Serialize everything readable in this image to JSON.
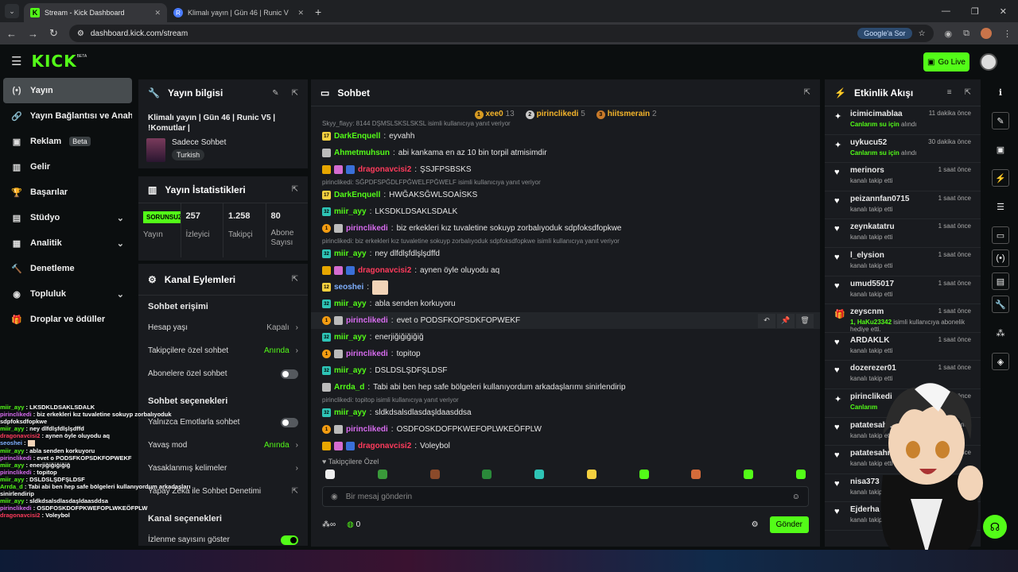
{
  "browser": {
    "tabs": [
      {
        "label": "Stream - Kick Dashboard",
        "active": true
      },
      {
        "label": "Klimalı yayın | Gün 46 | Runic V",
        "active": false
      }
    ],
    "url": "dashboard.kick.com/stream",
    "google_btn": "Google'a Sor"
  },
  "app": {
    "logo": "KICK",
    "beta": "BETA",
    "golive": "Go Live"
  },
  "sidebar": [
    {
      "icon": "(•)",
      "label": "Yayın",
      "active": true
    },
    {
      "icon": "🔗",
      "label": "Yayın Bağlantısı ve Anahtarı"
    },
    {
      "icon": "▣",
      "label": "Reklam",
      "badge": "Beta"
    },
    {
      "icon": "▥",
      "label": "Gelir"
    },
    {
      "icon": "🏆",
      "label": "Başarılar"
    },
    {
      "icon": "▤",
      "label": "Stüdyo",
      "chevron": true
    },
    {
      "icon": "▦",
      "label": "Analitik",
      "chevron": true
    },
    {
      "icon": "🔨",
      "label": "Denetleme"
    },
    {
      "icon": "◉",
      "label": "Topluluk",
      "chevron": true
    },
    {
      "icon": "🎁",
      "label": "Droplar ve ödüller"
    }
  ],
  "info": {
    "title": "Yayın bilgisi",
    "stream_title": "Klimalı yayın | Gün 46 | Runic V5 | !Komutlar |",
    "category": "Sadece Sohbet",
    "tag": "Turkish"
  },
  "stats": {
    "title": "Yayın İstatistikleri",
    "offline": "SORUNSUZ",
    "items": [
      {
        "label": "Yayın"
      },
      {
        "value": "257",
        "label": "İzleyici"
      },
      {
        "value": "1.258",
        "label": "Takipçi"
      },
      {
        "value": "80",
        "label": "Abone Sayısı"
      }
    ]
  },
  "actions": {
    "title": "Kanal Eylemleri",
    "sec1": "Sohbet erişimi",
    "r1": {
      "label": "Hesap yaşı",
      "value": "Kapalı"
    },
    "r2": {
      "label": "Takipçilere özel sohbet",
      "value": "Anında"
    },
    "r3": {
      "label": "Abonelere özel sohbet"
    },
    "sec2": "Sohbet seçenekleri",
    "r4": {
      "label": "Yalnızca Emotlarla sohbet"
    },
    "r5": {
      "label": "Yavaş mod",
      "value": "Anında"
    },
    "r6": {
      "label": "Yasaklanmış kelimeler"
    },
    "r7": {
      "label": "Yapay Zeka ile Sohbet Denetimi"
    },
    "sec3": "Kanal seçenekleri",
    "r8": {
      "label": "İzlenme sayısını göster"
    }
  },
  "chat": {
    "title": "Sohbet",
    "leaders": [
      {
        "rank": "1",
        "name": "xee0",
        "count": "13",
        "color": "#d69a22"
      },
      {
        "rank": "2",
        "name": "pirinclikedi",
        "count": "5",
        "color": "#c8c8c8"
      },
      {
        "rank": "3",
        "name": "hiitsmerain",
        "count": "2",
        "color": "#c87a2a"
      }
    ],
    "messages": [
      {
        "reply": "Skyy_flayy: 8144 DŞMSLSKSLSKSL isimli kullanıcıya yanıt veriyor"
      },
      {
        "badges": [
          "y:17"
        ],
        "user": "DarkEnquell",
        "color": "#53fc18",
        "text": "eyvahh"
      },
      {
        "badges": [
          "gh:"
        ],
        "user": "Ahmetmuhsun",
        "color": "#53fc18",
        "text": "abi kankama en az 10 bin torpil atmisimdir"
      },
      {
        "badges": [
          "c:",
          "p:",
          "s:"
        ],
        "user": "dragonavcisi2",
        "color": "#ff3b5c",
        "text": "ŞSJFPSBSKS"
      },
      {
        "reply": "pirinclikedi: SĞPDFSPĞDLFPĞWELFPĞWELF isimli kullanıcıya yanıt veriyor"
      },
      {
        "badges": [
          "y:17"
        ],
        "user": "DarkEnquell",
        "color": "#53fc18",
        "text": "HWĞAKSĞWLSOAİSKS"
      },
      {
        "badges": [
          "t:32"
        ],
        "user": "miir_ayy",
        "color": "#53fc18",
        "text": "LKSDKLDSAKLSDALK"
      },
      {
        "badges": [
          "o:1",
          "gh:"
        ],
        "user": "pirinclikedi",
        "color": "#d86cf0",
        "text": "biz erkekleri kız tuvaletine sokuyp zorbalıyoduk sdpfoksdfopkwe"
      },
      {
        "reply": "pirinclikedi: biz erkekleri kız tuvaletine sokuyp zorbalıyoduk sdpfoksdfopkwe isimli kullanıcıya yanıt veriyor"
      },
      {
        "badges": [
          "t:32"
        ],
        "user": "miir_ayy",
        "color": "#53fc18",
        "text": "ney dlfdlşfdlşlşdffd"
      },
      {
        "badges": [
          "c:",
          "p:",
          "s:"
        ],
        "user": "dragonavcisi2",
        "color": "#ff3b5c",
        "text": "aynen öyle oluyodu aq"
      },
      {
        "badges": [
          "y:12"
        ],
        "user": "seoshei",
        "color": "#7fb0ff",
        "text": "",
        "emote": true
      },
      {
        "badges": [
          "t:32"
        ],
        "user": "miir_ayy",
        "color": "#53fc18",
        "text": "abla senden korkuyoru"
      },
      {
        "badges": [
          "o:1",
          "gh:"
        ],
        "user": "pirinclikedi",
        "color": "#d86cf0",
        "text": "evet o PODSFKOPSDKFOPWEKF",
        "hover": true
      },
      {
        "badges": [
          "t:32"
        ],
        "user": "miir_ayy",
        "color": "#53fc18",
        "text": "enerjiğiğiğiğiğ"
      },
      {
        "badges": [
          "o:1",
          "gh:"
        ],
        "user": "pirinclikedi",
        "color": "#d86cf0",
        "text": "topitop"
      },
      {
        "badges": [
          "t:32"
        ],
        "user": "miir_ayy",
        "color": "#53fc18",
        "text": "DSLDSLŞDFŞLDSF"
      },
      {
        "badges": [
          "gh:"
        ],
        "user": "Arrda_d",
        "color": "#53fc18",
        "text": "Tabi abi ben hep safe bölgeleri kullanıyordum arkadaşlarımı sinirlendirip"
      },
      {
        "reply": "pirinclikedi: topitop isimli kullanıcıya yanıt veriyor"
      },
      {
        "badges": [
          "t:32"
        ],
        "user": "miir_ayy",
        "color": "#53fc18",
        "text": "sldkdsalsdlasdaşldaasddsa"
      },
      {
        "badges": [
          "o:1",
          "gh:"
        ],
        "user": "pirinclikedi",
        "color": "#d86cf0",
        "text": "OSDFOSKDOFPKWEFOPLWKEÖFPLW"
      },
      {
        "badges": [
          "c:",
          "p:",
          "s:"
        ],
        "user": "dragonavcisi2",
        "color": "#ff3b5c",
        "text": "Voleybol"
      }
    ],
    "subonly": "♥ Takipçilere Özel",
    "placeholder": "Bir mesaj gönderin",
    "infinity": "∞",
    "points": "0",
    "send": "Gönder"
  },
  "activity": {
    "title": "Etkinlik Akışı",
    "items": [
      {
        "icon": "✦",
        "name": "icimicimablaa",
        "time": "11 dakika önce",
        "sub": "Canlarım su için",
        "sub2": " alındı",
        "green": true
      },
      {
        "icon": "✦",
        "name": "uykucu52",
        "time": "30 dakika önce",
        "sub": "Canlarım su için",
        "sub2": " alındı",
        "green": true
      },
      {
        "icon": "♥",
        "name": "merinors",
        "time": "1 saat önce",
        "sub": "kanalı takip etti"
      },
      {
        "icon": "♥",
        "name": "peizannfan0715",
        "time": "1 saat önce",
        "sub": "kanalı takip etti"
      },
      {
        "icon": "♥",
        "name": "zeynkatatru",
        "time": "1 saat önce",
        "sub": "kanalı takip etti"
      },
      {
        "icon": "♥",
        "name": "l_elysion",
        "time": "1 saat önce",
        "sub": "kanalı takip etti"
      },
      {
        "icon": "♥",
        "name": "umud55017",
        "time": "1 saat önce",
        "sub": "kanalı takip etti"
      },
      {
        "icon": "🎁",
        "name": "zeyscnm",
        "time": "1 saat önce",
        "sub": "1, HaKu23342",
        "sub2": " isimli kullanıcıya abonelik hediye etti.",
        "green": true
      },
      {
        "icon": "♥",
        "name": "ARDAKLK",
        "time": "1 saat önce",
        "sub": "kanalı takip etti"
      },
      {
        "icon": "♥",
        "name": "dozerezer01",
        "time": "1 saat önce",
        "sub": "kanalı takip etti"
      },
      {
        "icon": "✦",
        "name": "pirinclikedi",
        "time": "1 saat önce",
        "sub": "Canlarım",
        "sub2": "",
        "green": true
      },
      {
        "icon": "♥",
        "name": "patatesahmet",
        "time": "1 saat önce",
        "sub": "kanalı takip etti"
      },
      {
        "icon": "♥",
        "name": "patatesahmet",
        "time": "1 saat önce",
        "sub": "kanalı takip etti"
      },
      {
        "icon": "♥",
        "name": "nisa373",
        "time": "1 saat önce",
        "sub": "kanalı takip etti"
      },
      {
        "icon": "♥",
        "name": "Ejderha",
        "time": "1 saat önce",
        "sub": "kanalı takip etti"
      }
    ]
  },
  "overlay": [
    {
      "user": "miir_ayy",
      "color": "#53fc18",
      "text": "LKSDKLDSAKLSDALK"
    },
    {
      "user": "pirinclikedi",
      "color": "#d86cf0",
      "text": "biz erkekleri kız tuvaletine sokuyp zorbalıyoduk"
    },
    {
      "user": "",
      "color": "#fff",
      "text": "sdpfoksdfopkwe"
    },
    {
      "user": "miir_ayy",
      "color": "#53fc18",
      "text": "ney dlfdlşfdlşlşdffd"
    },
    {
      "user": "dragonavcisi2",
      "color": "#ff3b5c",
      "text": "aynen öyle oluyodu aq"
    },
    {
      "user": "seoshei",
      "color": "#7fb0ff",
      "text": "",
      "emote": true
    },
    {
      "user": "miir_ayy",
      "color": "#53fc18",
      "text": "abla senden korkuyoru"
    },
    {
      "user": "pirinclikedi",
      "color": "#d86cf0",
      "text": "evet o PODSFKOPSDKFOPWEKF"
    },
    {
      "user": "miir_ayy",
      "color": "#53fc18",
      "text": "enerjiğiğiğiğiğ"
    },
    {
      "user": "pirinclikedi",
      "color": "#d86cf0",
      "text": "topitop"
    },
    {
      "user": "miir_ayy",
      "color": "#53fc18",
      "text": "DSLDSLŞDFŞLDSF"
    },
    {
      "user": "Arrda_d",
      "color": "#53fc18",
      "text": "Tabi abi ben hep safe bölgeleri kullanıyordum arkadaşlarımı"
    },
    {
      "user": "",
      "color": "#fff",
      "text": "sinirlendirip"
    },
    {
      "user": "miir_ayy",
      "color": "#53fc18",
      "text": "sldkdsalsdlasdaşldaasddsa"
    },
    {
      "user": "pirinclikedi",
      "color": "#d86cf0",
      "text": "OSDFOSKDOFPKWEFOPLWKEÖFPLW"
    },
    {
      "user": "dragonavcisi2",
      "color": "#ff3b5c",
      "text": "Voleybol"
    }
  ]
}
